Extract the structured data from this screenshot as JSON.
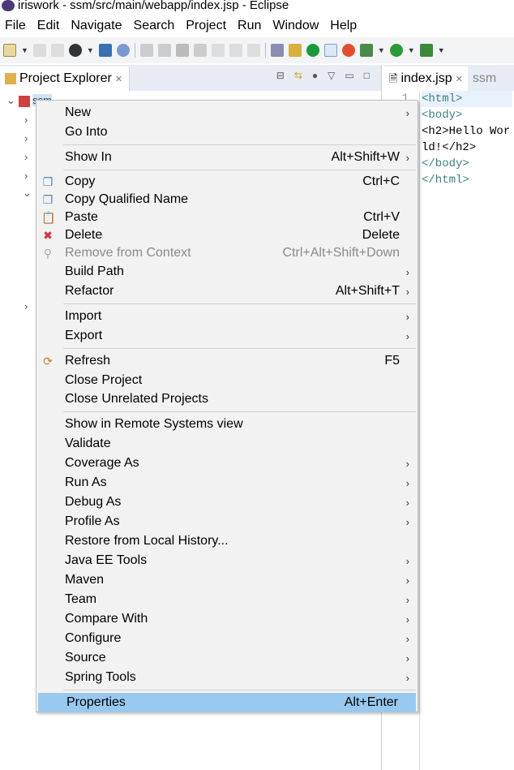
{
  "window": {
    "title": "iriswork - ssm/src/main/webapp/index.jsp - Eclipse"
  },
  "menubar": [
    "File",
    "Edit",
    "Navigate",
    "Search",
    "Project",
    "Run",
    "Window",
    "Help"
  ],
  "explorer": {
    "tab_label": "Project Explorer",
    "project": "ssm"
  },
  "editor": {
    "tab_label": "index.jsp",
    "tab2_label": "ssm",
    "line_number": "1",
    "code": [
      "<html>",
      "<body>",
      "<h2>Hello World!</h2>",
      "</body>",
      "</html>"
    ]
  },
  "context_menu": {
    "groups": [
      [
        {
          "label": "New",
          "submenu": true
        },
        {
          "label": "Go Into"
        }
      ],
      [
        {
          "label": "Show In",
          "shortcut": "Alt+Shift+W",
          "submenu": true
        }
      ],
      [
        {
          "label": "Copy",
          "shortcut": "Ctrl+C",
          "icon": "copy-icon"
        },
        {
          "label": "Copy Qualified Name",
          "icon": "copy-qualified-icon"
        },
        {
          "label": "Paste",
          "shortcut": "Ctrl+V",
          "icon": "paste-icon"
        },
        {
          "label": "Delete",
          "shortcut": "Delete",
          "icon": "delete-icon"
        },
        {
          "label": "Remove from Context",
          "shortcut": "Ctrl+Alt+Shift+Down",
          "disabled": true,
          "icon": "remove-context-icon"
        },
        {
          "label": "Build Path",
          "submenu": true
        },
        {
          "label": "Refactor",
          "shortcut": "Alt+Shift+T",
          "submenu": true
        }
      ],
      [
        {
          "label": "Import",
          "submenu": true
        },
        {
          "label": "Export",
          "submenu": true
        }
      ],
      [
        {
          "label": "Refresh",
          "shortcut": "F5",
          "icon": "refresh-icon"
        },
        {
          "label": "Close Project"
        },
        {
          "label": "Close Unrelated Projects"
        }
      ],
      [
        {
          "label": "Show in Remote Systems view"
        },
        {
          "label": "Validate"
        },
        {
          "label": "Coverage As",
          "submenu": true
        },
        {
          "label": "Run As",
          "submenu": true
        },
        {
          "label": "Debug As",
          "submenu": true
        },
        {
          "label": "Profile As",
          "submenu": true
        },
        {
          "label": "Restore from Local History..."
        },
        {
          "label": "Java EE Tools",
          "submenu": true
        },
        {
          "label": "Maven",
          "submenu": true
        },
        {
          "label": "Team",
          "submenu": true
        },
        {
          "label": "Compare With",
          "submenu": true
        },
        {
          "label": "Configure",
          "submenu": true
        },
        {
          "label": "Source",
          "submenu": true
        },
        {
          "label": "Spring Tools",
          "submenu": true
        }
      ],
      [
        {
          "label": "Properties",
          "shortcut": "Alt+Enter",
          "selected": true
        }
      ]
    ]
  },
  "colors": {
    "selection": "#99c9ef",
    "menu_bg": "#f2f2f2",
    "toolbar_bg": "#f3f4f6",
    "tag": "#3f7f7f"
  }
}
